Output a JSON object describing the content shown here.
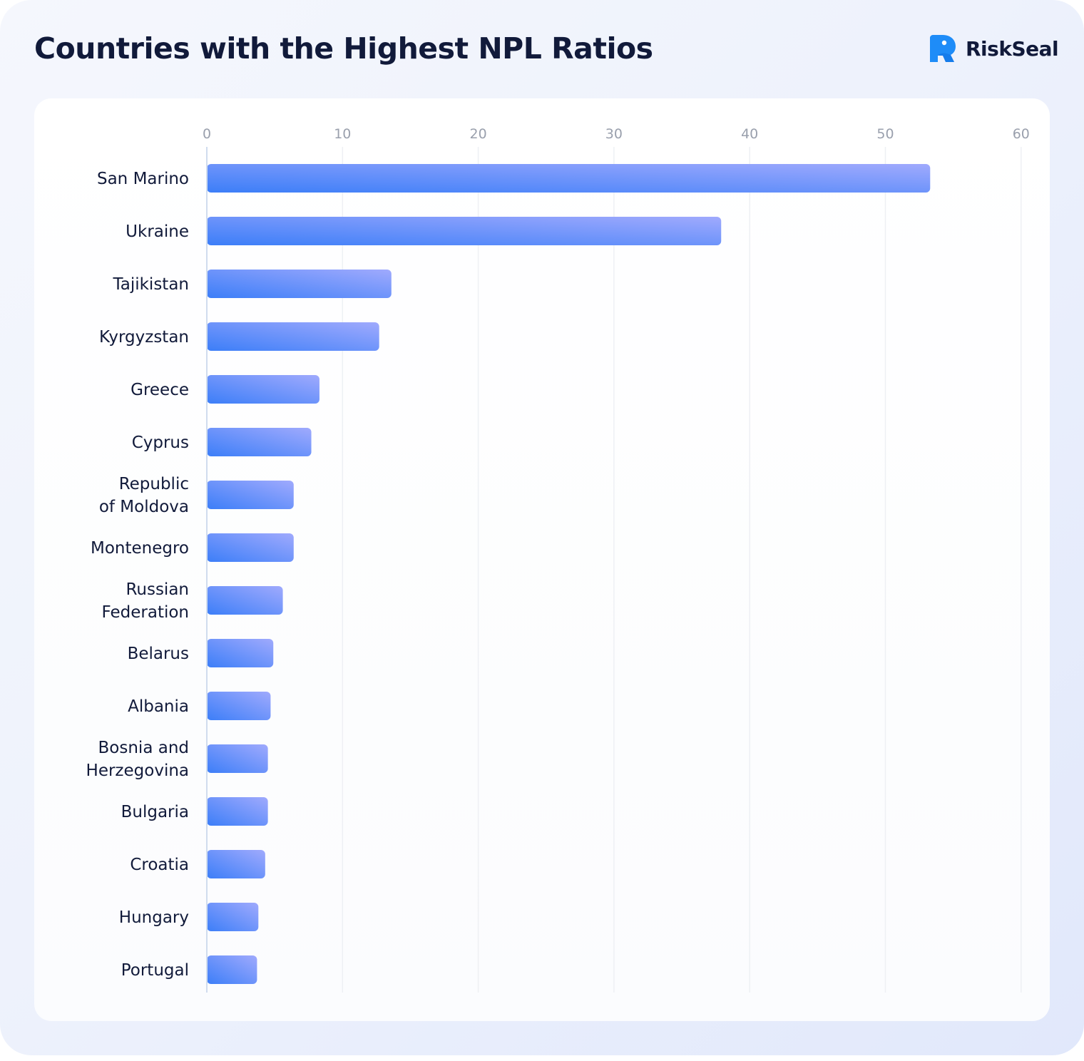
{
  "header": {
    "title": "Countries with the Highest NPL Ratios",
    "brand_name": "RiskSeal",
    "brand_icon": "riskseal-seal-logo-icon"
  },
  "colors": {
    "bar_start": "#3c7ef8",
    "bar_end": "#a0aafd",
    "title": "#111a3a",
    "tick_label": "#9aa0ad",
    "gridline": "#eef0f4",
    "axis": "#d0dcee",
    "logo": "#1e8cf8"
  },
  "chart_data": {
    "type": "bar",
    "orientation": "horizontal",
    "title": "Countries with the Highest NPL Ratios",
    "xlabel": "",
    "ylabel": "",
    "xlim": [
      0,
      60
    ],
    "xticks": [
      0,
      10,
      20,
      30,
      40,
      50,
      60
    ],
    "x_axis_position": "top",
    "grid": true,
    "legend": "none",
    "categories": [
      [
        "San Marino"
      ],
      [
        "Ukraine"
      ],
      [
        "Tajikistan"
      ],
      [
        "Kyrgyzstan"
      ],
      [
        "Greece"
      ],
      [
        "Cyprus"
      ],
      [
        "Republic",
        "of Moldova"
      ],
      [
        "Montenegro"
      ],
      [
        "Russian",
        "Federation"
      ],
      [
        "Belarus"
      ],
      [
        "Albania"
      ],
      [
        "Bosnia and",
        "Herzegovina"
      ],
      [
        "Bulgaria"
      ],
      [
        "Croatia"
      ],
      [
        "Hungary"
      ],
      [
        "Portugal"
      ]
    ],
    "values": [
      53.3,
      37.9,
      13.6,
      12.7,
      8.3,
      7.7,
      6.4,
      6.4,
      5.6,
      4.9,
      4.7,
      4.5,
      4.5,
      4.3,
      3.8,
      3.7
    ]
  }
}
